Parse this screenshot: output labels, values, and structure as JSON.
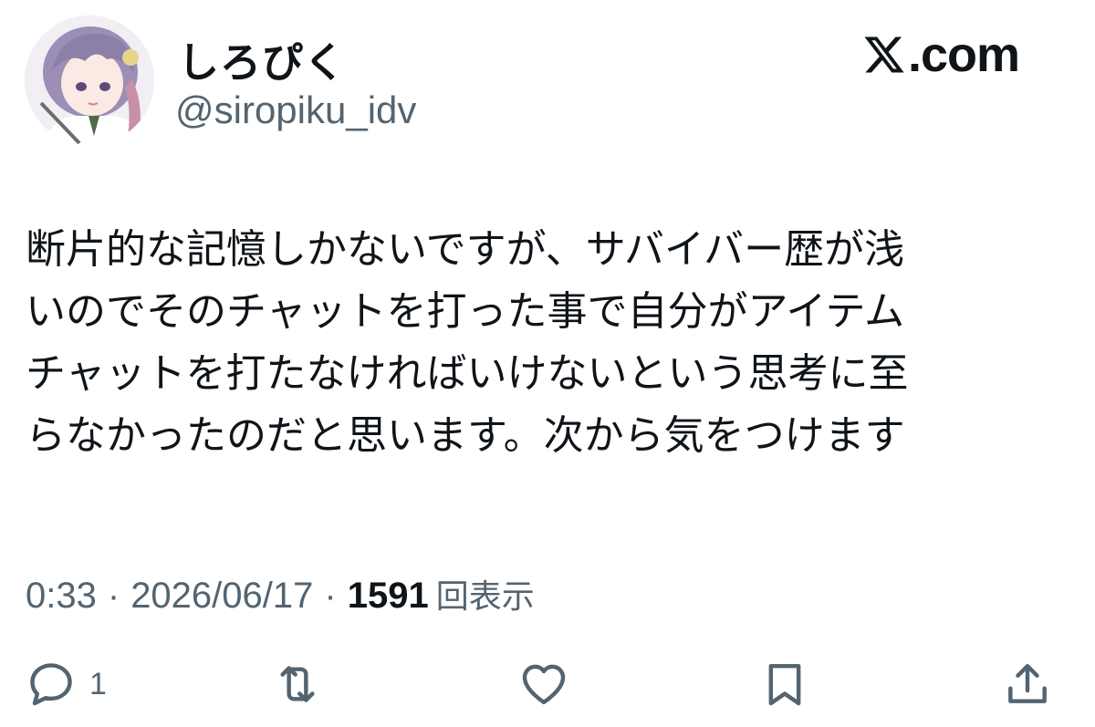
{
  "author": {
    "display_name": "しろぴく",
    "handle": "@siropiku_idv",
    "avatar_icon": "avatar-illustration"
  },
  "brand": {
    "logo_icon": "x-logo-icon",
    "logo_text": ".com"
  },
  "tweet": {
    "lines": [
      "断片的な記憶しかないですが、サバイバー歴が浅",
      "いのでそのチャットを打った事で自分がアイテム",
      "チャットを打たなければいけないという思考に至",
      "らなかったのだと思います。次から気をつけます"
    ]
  },
  "meta": {
    "time": "0:33",
    "separator": "·",
    "date": "2026/06/17",
    "views_count": "1591",
    "views_label": "回表示"
  },
  "actions": {
    "reply": {
      "icon": "reply-icon",
      "count": "1"
    },
    "retweet": {
      "icon": "retweet-icon"
    },
    "like": {
      "icon": "heart-icon"
    },
    "bookmark": {
      "icon": "bookmark-icon"
    },
    "share": {
      "icon": "share-icon"
    }
  },
  "colors": {
    "text": "#0f1419",
    "secondary": "#536471",
    "background": "#ffffff"
  }
}
